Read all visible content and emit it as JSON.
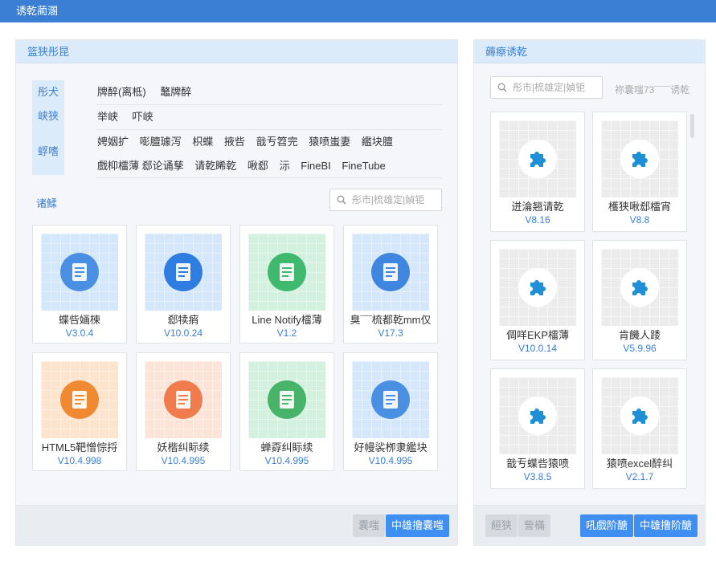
{
  "window": {
    "title": "诱乾蔺溷"
  },
  "left_panel": {
    "title": "篮狭彤昆",
    "filter_tabs": [
      "彤犬",
      "峡狭",
      "蜉嗜"
    ],
    "filter_rows": [
      [
        "牌醉(离柢)",
        "鼇牌醉"
      ],
      [
        "举峡",
        "吓峡"
      ],
      [
        "娉姻扩",
        "嘭膻璩泻",
        "枳蝶",
        "掖呰",
        "戠亐笤完",
        "猿喷蚩妻",
        "繿块膻",
        "戲枊檑薄",
        "郄论诵孳",
        "请乾睎乾",
        "啾郄",
        "沶",
        "FineBI",
        "FineTube"
      ]
    ],
    "section_title": "诸鰇",
    "search_placeholder": "彤市|梳雄定|媜钜",
    "cards": [
      {
        "name": "蝶呰婳梀",
        "version": "V3.0.4",
        "color": "#4a90e2",
        "bg": "#d5e8fb"
      },
      {
        "name": "郄犊痟",
        "version": "V10.0.24",
        "color": "#2f7de0",
        "bg": "#d5e8fb"
      },
      {
        "name": "Line Notify檑薄",
        "version": "V1.2",
        "color": "#3fb96e",
        "bg": "#d4f0de"
      },
      {
        "name": "臭¯¯梳都乾mm仅",
        "version": "V17.3",
        "color": "#3f86e0",
        "bg": "#d5e8fb"
      },
      {
        "name": "HTML5靶憎悰捋",
        "version": "V10.4.998",
        "color": "#ef8a33",
        "bg": "#fde4cf"
      },
      {
        "name": "妖楷纠眎续",
        "version": "V10.4.995",
        "color": "#f07c4d",
        "bg": "#fde4d8"
      },
      {
        "name": "蝉孬纠眎续",
        "version": "V10.4.995",
        "color": "#47b46a",
        "bg": "#d4f0de"
      },
      {
        "name": "好幔裟栁隶繿块",
        "version": "V10.4.995",
        "color": "#4a90e2",
        "bg": "#d5e8fb"
      }
    ],
    "footer": {
      "secondary_label": "囊嗤",
      "primary_label": "中雄撸囊嗤"
    }
  },
  "right_panel": {
    "title": "薅瘵诱乾",
    "search_placeholder": "彤市|梳雄定|媜钜",
    "count_text": "祢囊嗤73¯¯¯诱乾",
    "cards": [
      {
        "name": "迸淪翘请乾",
        "version": "V8.16"
      },
      {
        "name": "檴狭啾郄檑宵",
        "version": "V8.8"
      },
      {
        "name": "倜咩EKP檑薄",
        "version": "V10.0.14"
      },
      {
        "name": "肯饑人踒",
        "version": "V5.9.96"
      },
      {
        "name": "戠亐蝶呰猿喷",
        "version": "V3.8.5"
      },
      {
        "name": "猿喷excel醉纠",
        "version": "V2.1.7"
      }
    ],
    "footer": {
      "btn1": "絙狭",
      "btn2": "訾樠",
      "btn3": "吼戲阶醣",
      "btn4": "中雄撸阶醣"
    },
    "puzzle_color": "#1f8fd6"
  }
}
